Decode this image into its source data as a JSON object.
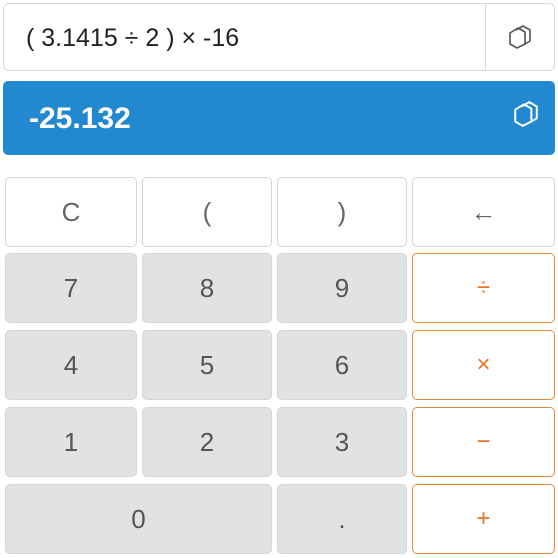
{
  "expression": {
    "text": "( 3.1415 ÷ 2 ) × -16",
    "copy_icon": "copy-icon"
  },
  "result": {
    "text": "-25.132",
    "copy_icon": "copy-icon"
  },
  "colors": {
    "result_bg": "#2288d0",
    "operator_accent": "#e58a3c",
    "digit_bg": "#e1e2e4"
  },
  "keypad": {
    "clear": "C",
    "open_paren": "(",
    "close_paren": ")",
    "backspace": "←",
    "seven": "7",
    "eight": "8",
    "nine": "9",
    "divide": "÷",
    "four": "4",
    "five": "5",
    "six": "6",
    "multiply": "×",
    "one": "1",
    "two": "2",
    "three": "3",
    "minus": "−",
    "zero": "0",
    "decimal": ".",
    "plus": "+"
  }
}
